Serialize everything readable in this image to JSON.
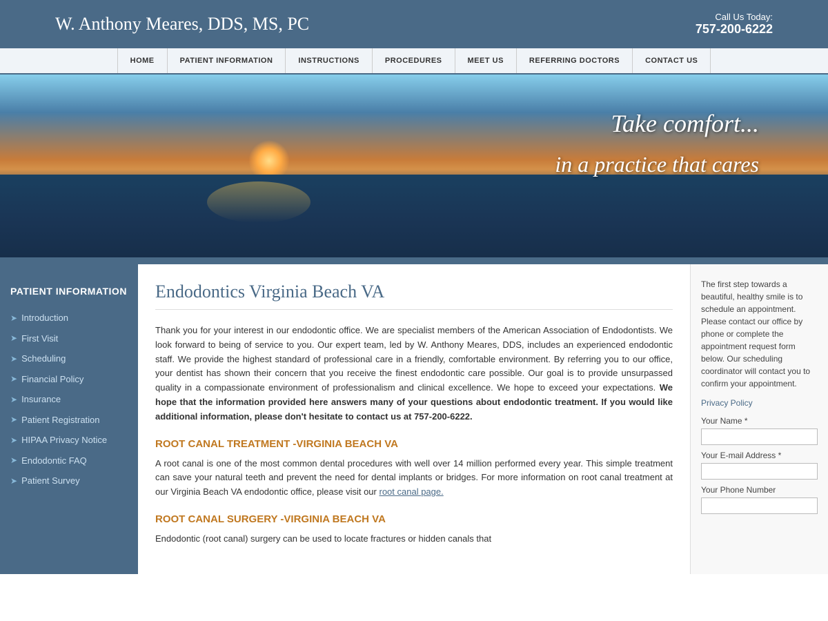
{
  "header": {
    "site_title": "W. Anthony Meares, DDS, MS, PC",
    "call_label": "Call Us Today:",
    "phone": "757-200-6222"
  },
  "nav": {
    "items": [
      {
        "label": "HOME",
        "href": "#"
      },
      {
        "label": "PATIENT INFORMATION",
        "href": "#"
      },
      {
        "label": "INSTRUCTIONS",
        "href": "#"
      },
      {
        "label": "PROCEDURES",
        "href": "#"
      },
      {
        "label": "MEET US",
        "href": "#"
      },
      {
        "label": "REFERRING DOCTORS",
        "href": "#"
      },
      {
        "label": "CONTACT US",
        "href": "#"
      }
    ]
  },
  "hero": {
    "line1": "Take comfort...",
    "line2": "in a practice that cares"
  },
  "sidebar": {
    "title": "PATIENT INFORMATION",
    "items": [
      {
        "label": "Introduction",
        "href": "#"
      },
      {
        "label": "First Visit",
        "href": "#"
      },
      {
        "label": "Scheduling",
        "href": "#"
      },
      {
        "label": "Financial Policy",
        "href": "#"
      },
      {
        "label": "Insurance",
        "href": "#"
      },
      {
        "label": "Patient Registration",
        "href": "#"
      },
      {
        "label": "HIPAA Privacy Notice",
        "href": "#"
      },
      {
        "label": "Endodontic FAQ",
        "href": "#"
      },
      {
        "label": "Patient Survey",
        "href": "#"
      }
    ]
  },
  "main": {
    "page_title": "Endodontics Virginia Beach VA",
    "intro_paragraph": "Thank you for your interest in our endodontic office. We are specialist members of the American Association of Endodontists. We look forward to being of service to you. Our expert team, led by W. Anthony Meares, DDS, includes an experienced endodontic staff. We provide the highest standard of professional care in a friendly, comfortable environment. By referring you to our office, your dentist has shown their concern that you receive the finest endodontic care possible. Our goal is to provide unsurpassed quality in a compassionate environment of professionalism and clinical excellence. We hope to exceed your expectations.",
    "intro_bold": "We hope that the information provided here answers many of your questions about endodontic treatment. If you would like additional information, please don't hesitate to contact us at 757-200-6222.",
    "section1_title": "ROOT CANAL TREATMENT -VIRGINIA BEACH VA",
    "section1_paragraph": "A root canal is one of the most common dental procedures with well over 14 million performed every year. This simple treatment can save your natural teeth and prevent the need for dental implants or bridges. For more information on root canal treatment at our Virginia Beach VA endodontic office, please visit our",
    "section1_link": "root canal page.",
    "section2_title": "ROOT CANAL SURGERY -VIRGINIA BEACH VA",
    "section2_paragraph": "Endodontic (root canal) surgery can be used to locate fractures or hidden canals that"
  },
  "right_panel": {
    "blurb": "The first step towards a beautiful, healthy smile is to schedule an appointment. Please contact our office by phone or complete the appointment request form below. Our scheduling coordinator will contact you to confirm your appointment.",
    "privacy_link": "Privacy Policy",
    "fields": [
      {
        "label": "Your Name *",
        "type": "text"
      },
      {
        "label": "Your E-mail Address *",
        "type": "text"
      },
      {
        "label": "Your Phone Number",
        "type": "text"
      }
    ]
  }
}
